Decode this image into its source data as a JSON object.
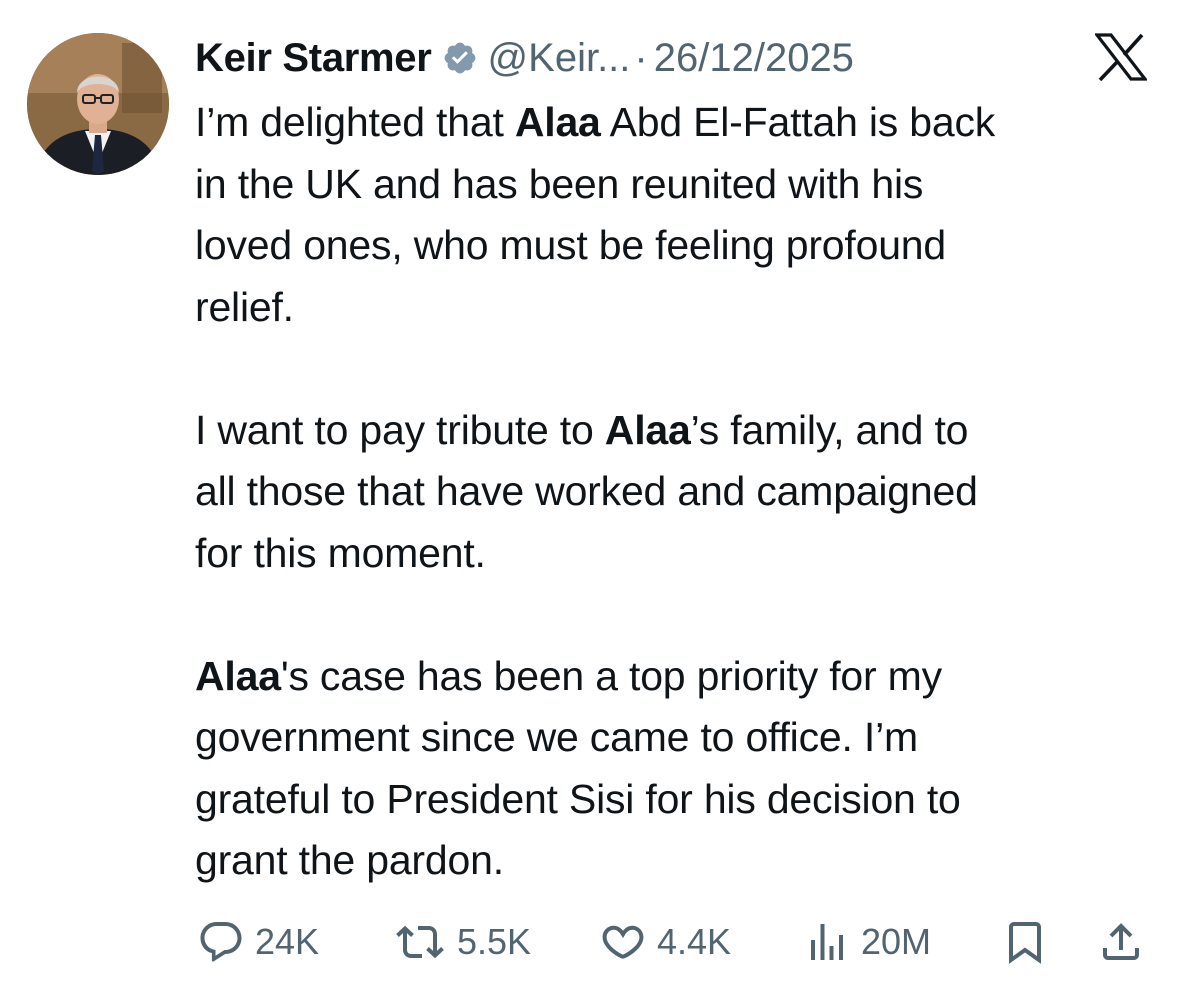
{
  "author": {
    "name": "Keir Starmer",
    "handle": "@Keir...",
    "separator": "·",
    "date": "26/12/2025",
    "verified": true
  },
  "platform_icon": "x-logo-icon",
  "tweet": {
    "paragraphs": [
      [
        {
          "text": "I’m delighted that ",
          "bold": false
        },
        {
          "text": "Alaa",
          "bold": true
        },
        {
          "text": " Abd El-Fattah is back",
          "bold": false
        },
        {
          "text": "in the UK and has been reunited with his",
          "bold": false,
          "newline": true
        },
        {
          "text": "loved ones, who must be feeling profound",
          "bold": false,
          "newline": true
        },
        {
          "text": "relief.",
          "bold": false,
          "newline": true
        }
      ],
      [
        {
          "text": "I want to pay tribute to ",
          "bold": false
        },
        {
          "text": "Alaa",
          "bold": true
        },
        {
          "text": "’s family, and to",
          "bold": false
        },
        {
          "text": "all those that have worked and campaigned",
          "bold": false,
          "newline": true
        },
        {
          "text": "for this moment.",
          "bold": false,
          "newline": true
        }
      ],
      [
        {
          "text": "Alaa",
          "bold": true
        },
        {
          "text": "'s case has been a top priority for my",
          "bold": false
        },
        {
          "text": "government since we came to office. I’m",
          "bold": false,
          "newline": true
        },
        {
          "text": "grateful to President Sisi for his decision to",
          "bold": false,
          "newline": true
        },
        {
          "text": "grant the pardon.",
          "bold": false,
          "newline": true
        }
      ]
    ]
  },
  "actions": {
    "replies": {
      "icon": "reply-icon",
      "count": "24K"
    },
    "reposts": {
      "icon": "repost-icon",
      "count": "5.5K"
    },
    "likes": {
      "icon": "heart-icon",
      "count": "4.4K"
    },
    "views": {
      "icon": "views-icon",
      "count": "20M"
    },
    "bookmark": {
      "icon": "bookmark-icon"
    },
    "share": {
      "icon": "share-icon"
    }
  },
  "colors": {
    "text": "#0f1419",
    "secondary": "#536471",
    "verified_badge": "#829aab"
  }
}
